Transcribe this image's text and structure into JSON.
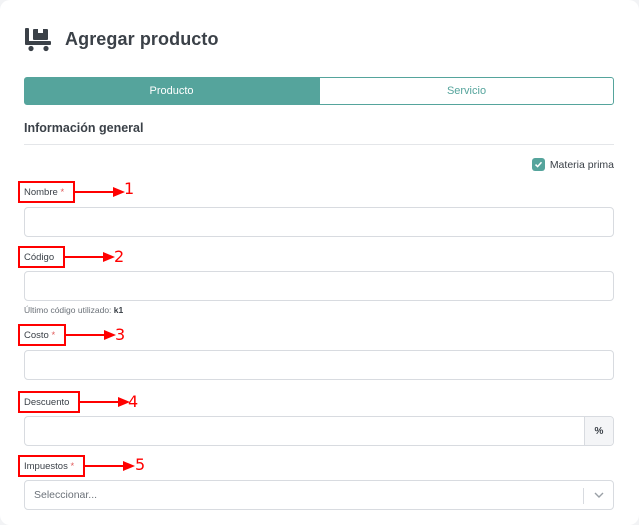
{
  "header": {
    "title": "Agregar producto",
    "icon": "cart-box-icon"
  },
  "tabs": [
    {
      "label": "Producto",
      "active": true
    },
    {
      "label": "Servicio",
      "active": false
    }
  ],
  "section": {
    "title": "Información general"
  },
  "checkbox": {
    "label": "Materia prima",
    "checked": true
  },
  "fields": {
    "nombre": {
      "label": "Nombre",
      "required": "*",
      "value": ""
    },
    "codigo": {
      "label": "Código",
      "value": "",
      "hint": "Último código utilizado:",
      "hint_value": "k1"
    },
    "costo": {
      "label": "Costo",
      "required": "*",
      "value": ""
    },
    "descuento": {
      "label": "Descuento",
      "value": "",
      "addon": "%"
    },
    "impuestos": {
      "label": "Impuestos",
      "required": "*",
      "placeholder": "Seleccionar..."
    }
  },
  "annotations": [
    "1",
    "2",
    "3",
    "4",
    "5"
  ],
  "colors": {
    "accent": "#55a49c",
    "annotation": "#ff0000",
    "required": "#e05b5b"
  }
}
